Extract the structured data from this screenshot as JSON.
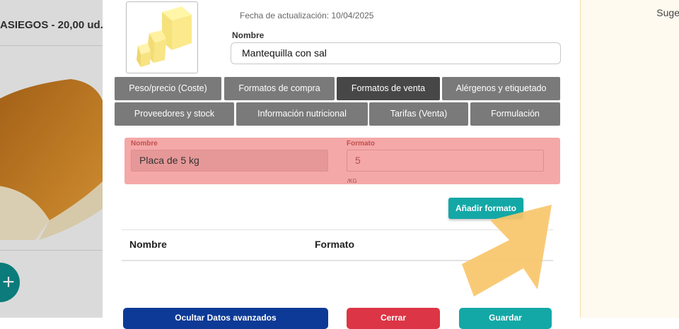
{
  "background": {
    "product_title": "ASIEGOS - 20,00 ud.",
    "add_button_icon": "plus-icon",
    "right_panel_label": "Suge"
  },
  "product": {
    "updated_label": "Fecha de actualización: 10/04/2025",
    "name_label": "Nombre",
    "name_value": "Mantequilla con sal",
    "thumbnail_icon": "butter-image"
  },
  "tabs": [
    {
      "label": "Peso/precio (Coste)",
      "active": false
    },
    {
      "label": "Formatos de compra",
      "active": false
    },
    {
      "label": "Formatos de venta",
      "active": true
    },
    {
      "label": "Alérgenos y etiquetado",
      "active": false
    },
    {
      "label": "Proveedores y stock",
      "active": false
    },
    {
      "label": "Información nutricional",
      "active": false
    },
    {
      "label": "Tarifas (Venta)",
      "active": false
    },
    {
      "label": "Formulación",
      "active": false
    }
  ],
  "format_form": {
    "name_label": "Nombre",
    "name_value": "Placa de 5 kg",
    "format_label": "Formato",
    "format_value": "5",
    "format_unit": "/KG",
    "add_button": "Añadir formato"
  },
  "formats_table": {
    "columns": [
      "Nombre",
      "Formato"
    ],
    "rows": []
  },
  "footer": {
    "hide_advanced": "Ocultar Datos avanzados",
    "close": "Cerrar",
    "save": "Guardar"
  },
  "colors": {
    "tab": "#7a7a7a",
    "tab_active": "#474747",
    "error_bg": "#f5a8a8",
    "accent": "#13a8a6",
    "hide_button": "#0d3a96",
    "close_button": "#dc3545",
    "save_button": "#13a8a6",
    "pointer": "#f8c56a"
  }
}
